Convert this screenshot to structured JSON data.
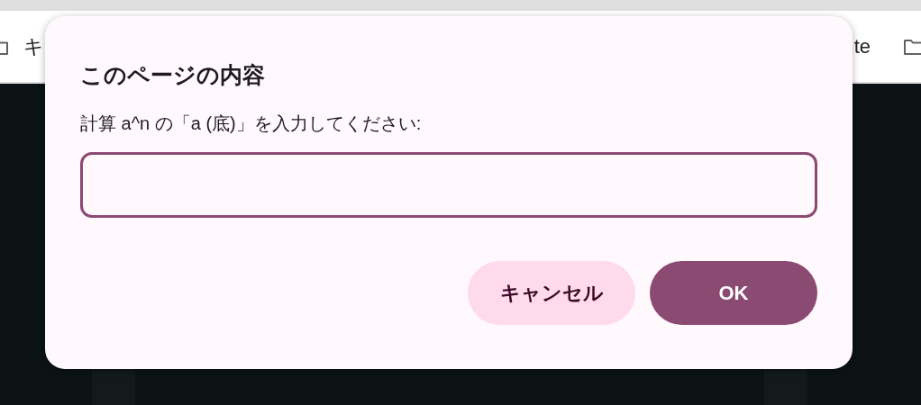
{
  "bookmarks_bar": {
    "items": [
      {
        "label": "キ"
      },
      {
        "label": "te"
      }
    ]
  },
  "dialog": {
    "title": "このページの内容",
    "message": "計算 a^n の「a (底)」を入力してください:",
    "input": {
      "focused": true
    },
    "buttons": [
      {
        "label": "キャンセル",
        "kind": "secondary"
      },
      {
        "label": "OK",
        "kind": "primary"
      }
    ]
  }
}
